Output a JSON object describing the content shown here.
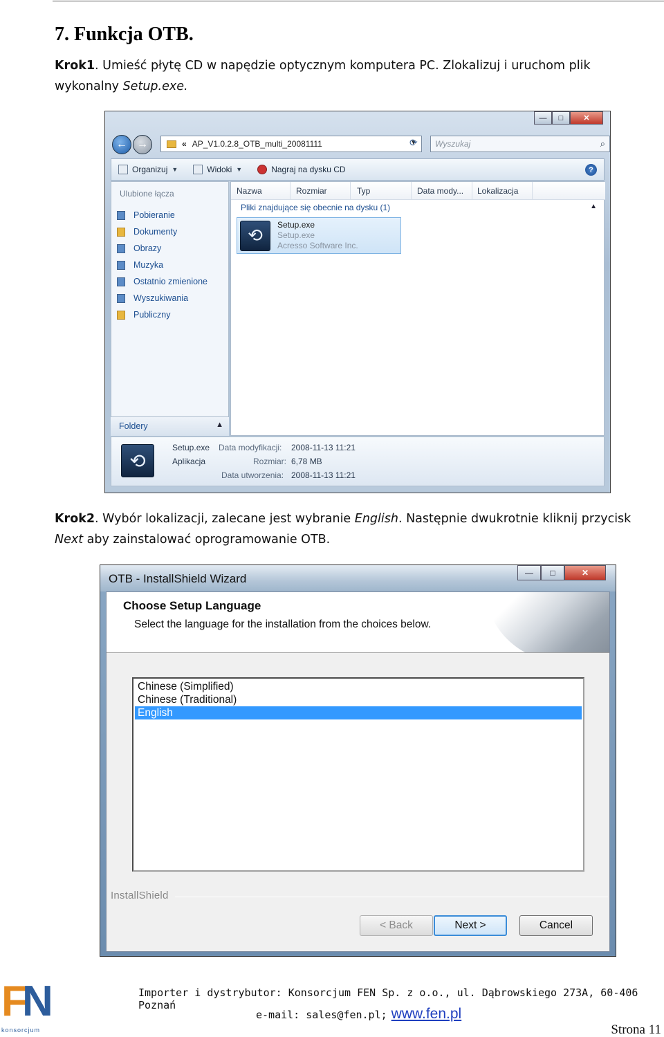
{
  "section_title": "7. Funkcja OTB.",
  "step1": {
    "label": "Krok1",
    "text": ". Umieść płytę CD w napędzie optycznym komputera PC. Zlokalizuj i uruchom plik wykonalny ",
    "filename": "Setup.exe."
  },
  "explorer": {
    "address": "AP_V1.0.2.8_OTB_multi_20081111",
    "address_prefix": "«",
    "search_placeholder": "Wyszukaj",
    "toolbar": [
      "Organizuj",
      "Widoki",
      "Nagraj na dysku CD"
    ],
    "sidebar_heading": "Ulubione łącza",
    "favorites": [
      "Pobieranie",
      "Dokumenty",
      "Obrazy",
      "Muzyka",
      "Ostatnio zmienione",
      "Wyszukiwania",
      "Publiczny"
    ],
    "folders_label": "Foldery",
    "columns": [
      "Nazwa",
      "Rozmiar",
      "Typ",
      "Data mody...",
      "Lokalizacja"
    ],
    "group_label": "Pliki znajdujące się obecnie na dysku (1)",
    "file": {
      "name": "Setup.exe",
      "desc": "Setup.exe",
      "company": "Acresso Software Inc."
    },
    "details": {
      "name": "Setup.exe",
      "type": "Aplikacja",
      "modified_label": "Data modyfikacji:",
      "modified_value": "2008-11-13 11:21",
      "size_label": "Rozmiar:",
      "size_value": "6,78 MB",
      "created_label": "Data utworzenia:",
      "created_value": "2008-11-13 11:21"
    }
  },
  "step2": {
    "label": "Krok2",
    "text_a": ". Wybór lokalizacji, zalecane jest wybranie ",
    "english": "English",
    "text_b": ". Następnie dwukrotnie kliknij przycisk ",
    "next": "Next",
    "text_c": " aby zainstalować oprogramowanie OTB."
  },
  "wizard": {
    "title": "OTB - InstallShield Wizard",
    "heading": "Choose Setup Language",
    "subheading": "Select the language for the installation from the choices below.",
    "languages": [
      "Chinese (Simplified)",
      "Chinese (Traditional)",
      "English"
    ],
    "selected_index": 2,
    "brand": "InstallShield",
    "back": "< Back",
    "next": "Next >",
    "cancel": "Cancel"
  },
  "footer": {
    "logo_sub": "konsorcjum",
    "line1": "Importer i dystrybutor: Konsorcjum FEN Sp. z o.o., ul. Dąbrowskiego 273A, 60-406 Poznań",
    "email_text": "e-mail: sales@fen.pl;",
    "website": "www.fen.pl",
    "page": "Strona 11"
  }
}
